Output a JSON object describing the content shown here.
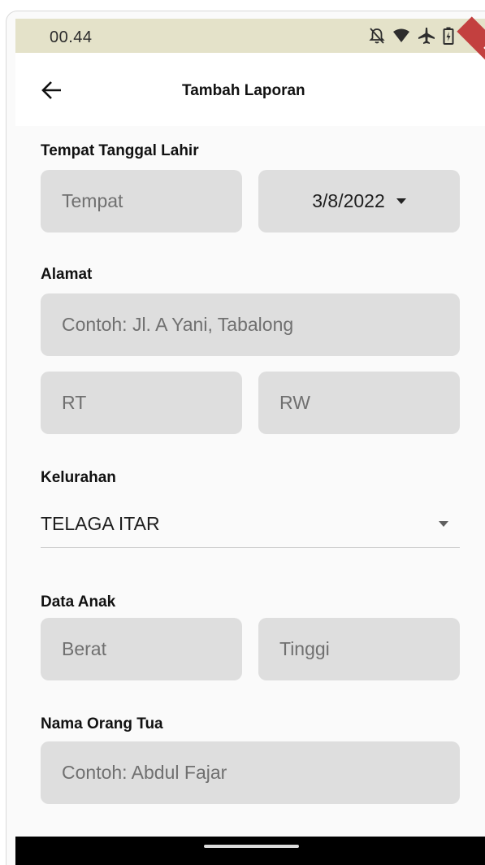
{
  "status_bar": {
    "time": "00.44"
  },
  "app_bar": {
    "title": "Tambah Laporan",
    "debug_banner": "DEBUG"
  },
  "form": {
    "birth_section_label": "Tempat Tanggal Lahir",
    "place_placeholder": "Tempat",
    "birth_date": "3/8/2022",
    "address_label": "Alamat",
    "address_placeholder": "Contoh: Jl. A Yani, Tabalong",
    "rt_placeholder": "RT",
    "rw_placeholder": "RW",
    "kelurahan_label": "Kelurahan",
    "kelurahan_value": "TELAGA ITAR",
    "child_data_label": "Data Anak",
    "weight_placeholder": "Berat",
    "height_placeholder": "Tinggi",
    "parent_name_label": "Nama Orang Tua",
    "parent_name_placeholder": "Contoh: Abdul Fajar"
  },
  "icons": {
    "status": [
      "notifications-off-icon",
      "wifi-icon",
      "airplane-icon",
      "battery-icon"
    ],
    "back": "arrow-back-icon"
  },
  "colors": {
    "status_bar_bg": "#e4e2c9",
    "field_bg": "#dedede",
    "debug_banner": "#c3403f"
  }
}
